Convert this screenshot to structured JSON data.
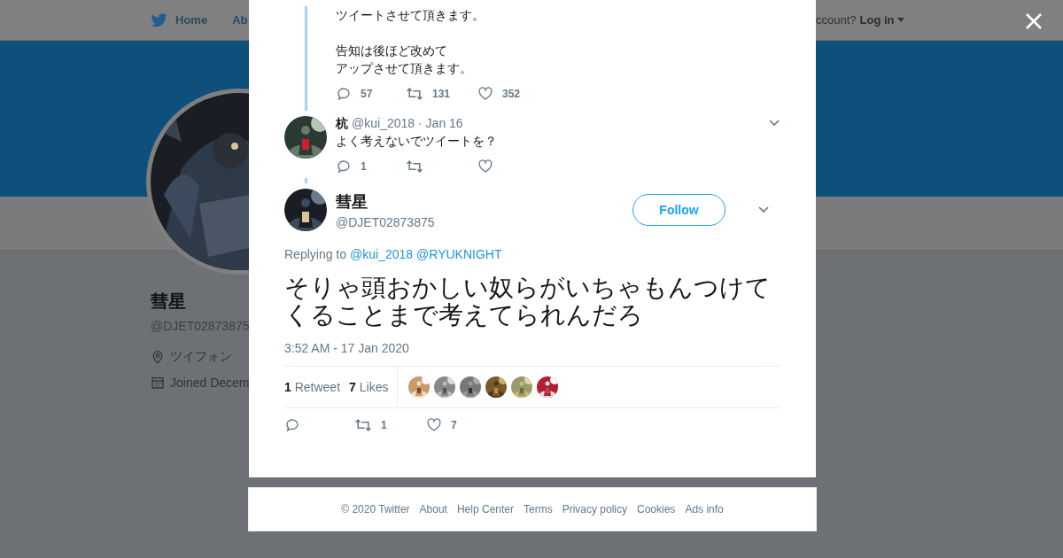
{
  "nav": {
    "items": [
      "Home",
      "Ab"
    ],
    "login_prompt": "ccount?",
    "login": "Log in"
  },
  "profile": {
    "name": "彗星",
    "handle": "@DJET02873875",
    "location": "ツイフォン",
    "joined": "Joined Decem"
  },
  "context_tweet": {
    "lines": [
      "ツイートさせて頂きます。",
      "告知は後ほど改めて",
      "アップさせて頂きます。"
    ],
    "actions": {
      "replies": "57",
      "retweets": "131",
      "likes": "352"
    }
  },
  "reply_tweet": {
    "name": "杭",
    "handle": "@kui_2018",
    "time": "· Jan 16",
    "text": "よく考えないでツイートを？",
    "actions": {
      "replies": "1"
    }
  },
  "tweet": {
    "name": "彗星",
    "handle": "@DJET02873875",
    "follow": "Follow",
    "replying_label": "Replying to",
    "replying_to": [
      "@kui_2018",
      "@RYUKNIGHT"
    ],
    "text": "そりゃ頭おかしい奴らがいちゃもんつけてくることまで考えてられんだろ",
    "timestamp": "3:52 AM - 17 Jan 2020",
    "retweet_count": "1",
    "retweet_label": "Retweet",
    "like_count": "7",
    "like_label": "Likes",
    "actions": {
      "retweets": "1",
      "likes": "7"
    }
  },
  "footer": [
    "© 2020 Twitter",
    "About",
    "Help Center",
    "Terms",
    "Privacy policy",
    "Cookies",
    "Ads info"
  ]
}
